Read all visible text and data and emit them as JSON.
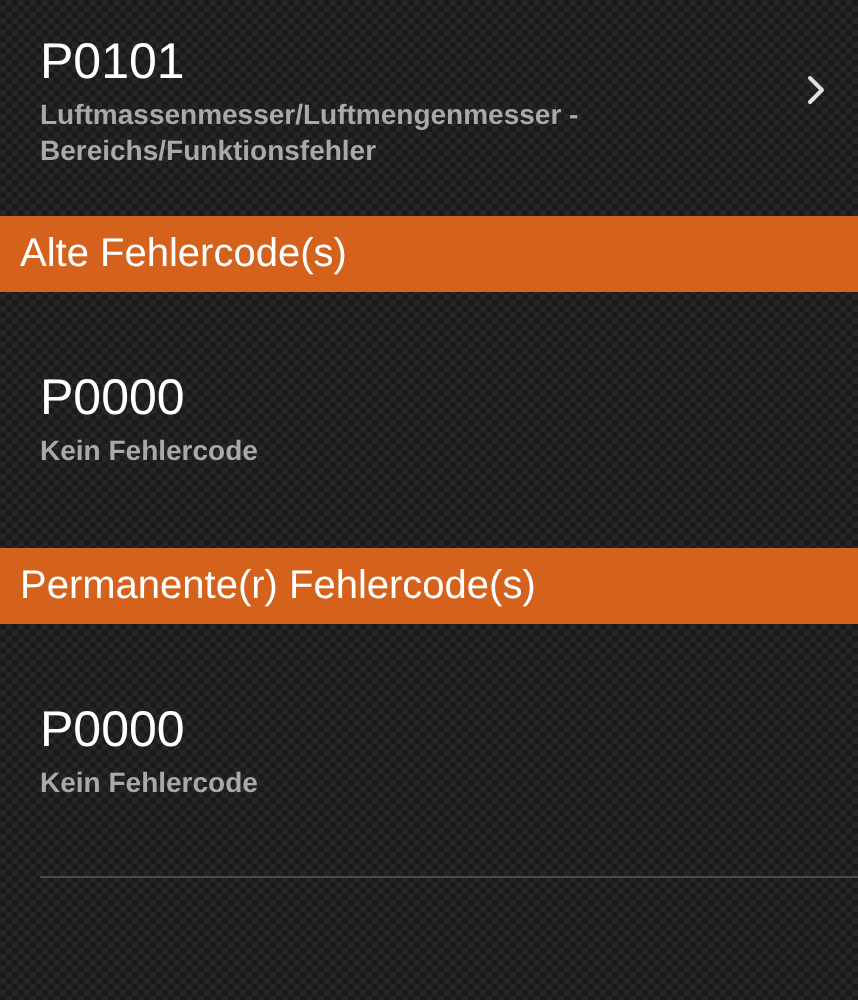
{
  "sections": [
    {
      "items": [
        {
          "code": "P0101",
          "description": "Luftmassenmesser/Luftmengenmesser - Bereichs/Funktionsfehler",
          "has_detail": true
        }
      ]
    },
    {
      "title": "Alte Fehlercode(s)",
      "items": [
        {
          "code": "P0000",
          "description": "Kein Fehlercode",
          "has_detail": false
        }
      ]
    },
    {
      "title": "Permanente(r) Fehlercode(s)",
      "items": [
        {
          "code": "P0000",
          "description": "Kein Fehlercode",
          "has_detail": false
        }
      ]
    }
  ]
}
